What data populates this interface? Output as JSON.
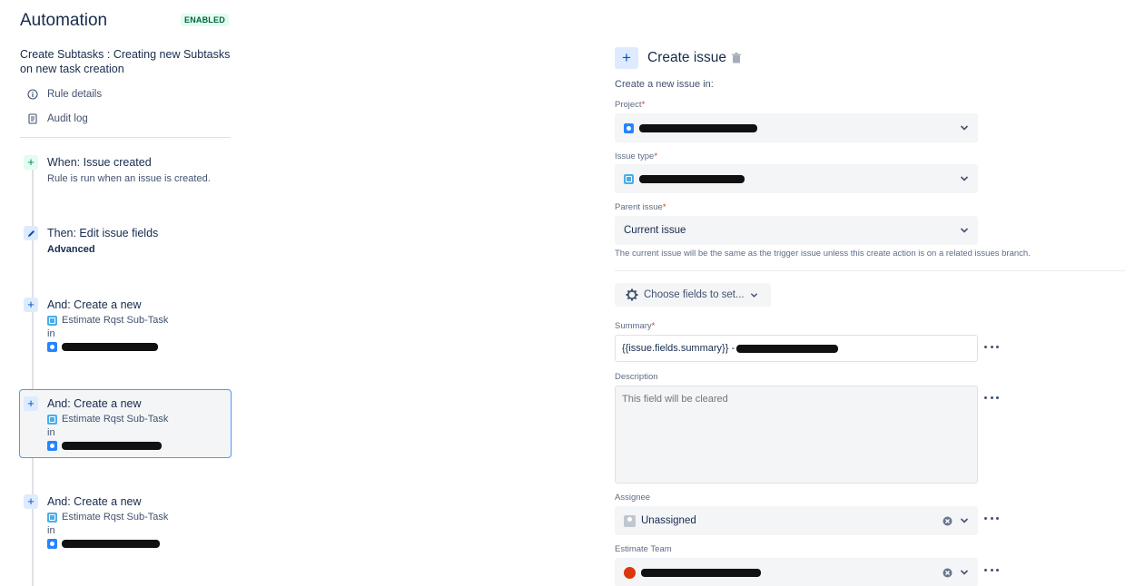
{
  "header": {
    "title": "Automation",
    "status_badge": "ENABLED"
  },
  "rule": {
    "name": "Create Subtasks : Creating new Subtasks on new task creation",
    "links": [
      {
        "label": "Rule details",
        "icon": "info-icon"
      },
      {
        "label": "Audit log",
        "icon": "document-icon"
      }
    ]
  },
  "steps": [
    {
      "title": "When: Issue created",
      "subtitle": "Rule is run when an issue is created.",
      "icon": "plus-icon"
    },
    {
      "title": "Then: Edit issue fields",
      "detail": "Advanced",
      "icon": "pencil-icon"
    },
    {
      "title": "And: Create a new",
      "issue_type": "Estimate Rqst Sub-Task",
      "in_label": "in",
      "icon": "plus-icon"
    },
    {
      "title": "And: Create a new",
      "issue_type": "Estimate Rqst Sub-Task",
      "in_label": "in",
      "icon": "plus-icon",
      "selected": true
    },
    {
      "title": "And: Create a new",
      "issue_type": "Estimate Rqst Sub-Task",
      "in_label": "in",
      "icon": "plus-icon"
    }
  ],
  "panel": {
    "add_label": "+",
    "title": "Create issue",
    "intro": "Create a new issue in:",
    "required_mark": "*",
    "project_label": "Project",
    "issue_type_label": "Issue type",
    "parent_label": "Parent issue",
    "parent_value": "Current issue",
    "parent_helper": "The current issue will be the same as the trigger issue unless this create action is on a related issues branch.",
    "choose_fields_label": "Choose fields to set...",
    "summary_label": "Summary",
    "summary_value": "{{issue.fields.summary}} -",
    "description_label": "Description",
    "description_placeholder": "This field will be cleared",
    "assignee_label": "Assignee",
    "assignee_value": "Unassigned",
    "estimate_team_label": "Estimate Team"
  },
  "colors": {
    "accent": "#0052cc",
    "selected_border": "#4c9aff",
    "enabled_bg": "#e3fcef",
    "enabled_text": "#006644",
    "field_bg": "#f4f5f7"
  }
}
